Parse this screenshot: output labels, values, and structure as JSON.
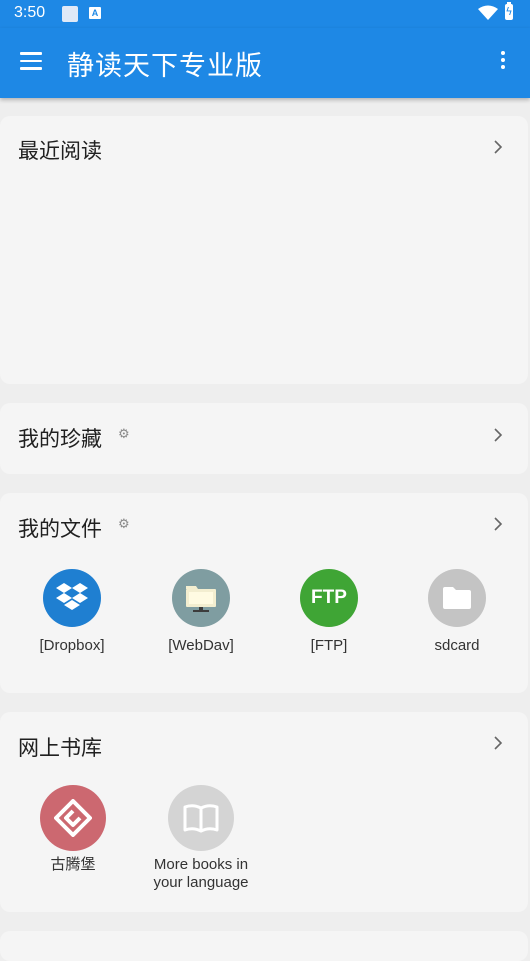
{
  "status": {
    "time": "3:50",
    "notif_icon": "A"
  },
  "appbar": {
    "title": "静读天下专业版"
  },
  "sections": {
    "recent": {
      "title": "最近阅读"
    },
    "favorites": {
      "title": "我的珍藏"
    },
    "files": {
      "title": "我的文件",
      "items": [
        {
          "label": "[Dropbox]",
          "icon": "dropbox-icon",
          "color": "#1f7fd1"
        },
        {
          "label": "[WebDav]",
          "icon": "webdav-icon",
          "color": "#7f9da1"
        },
        {
          "label": "[FTP]",
          "icon": "ftp-icon",
          "color": "#3fa535",
          "icon_text": "FTP"
        },
        {
          "label": "sdcard",
          "icon": "folder-icon",
          "color": "#c4c4c4"
        }
      ]
    },
    "online": {
      "title": "网上书库",
      "items": [
        {
          "label": "古腾堡",
          "icon": "gutenberg-icon",
          "color": "#cc6870"
        },
        {
          "label_line1": "More books in",
          "label_line2": "your language",
          "icon": "book-open-icon",
          "color": "#d4d4d4"
        }
      ]
    }
  },
  "colors": {
    "primary": "#1e88e5",
    "card_bg": "#f5f5f5",
    "page_bg": "#eeeeee"
  }
}
